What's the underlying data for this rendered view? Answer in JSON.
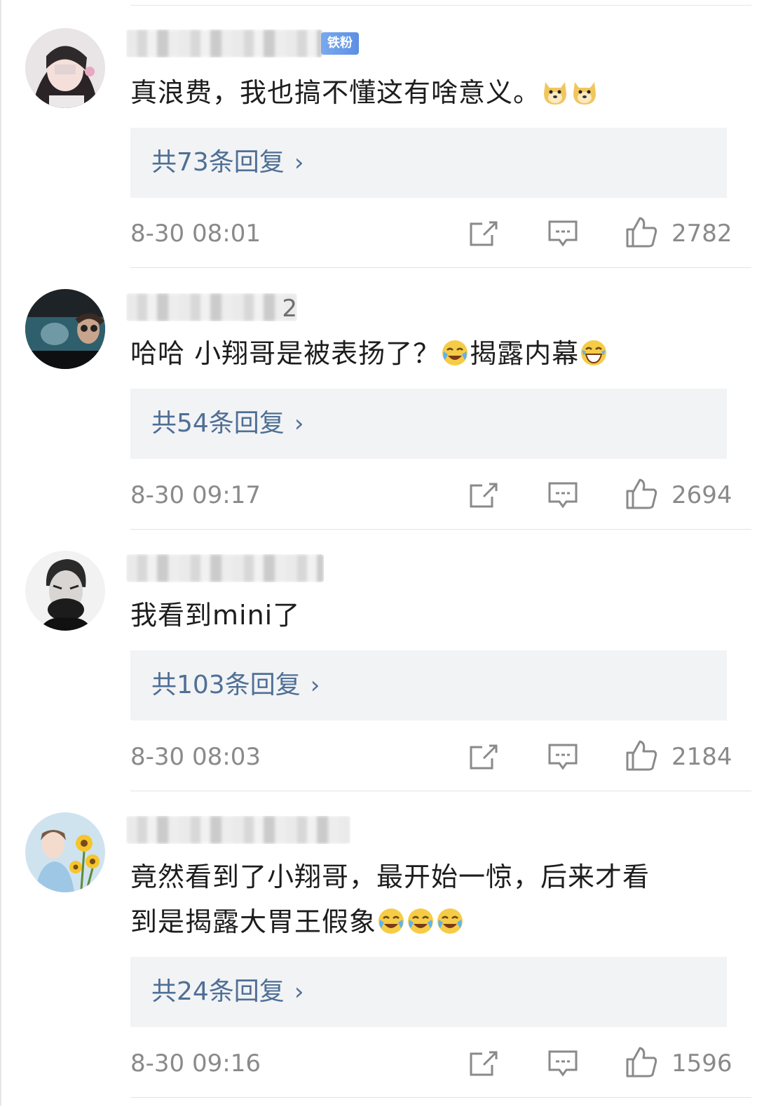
{
  "comments": [
    {
      "username_visible": "",
      "badge": "铁粉",
      "text": "真浪费，我也搞不懂这有啥意义。",
      "emojis": [
        "doge-emoji",
        "doge-emoji"
      ],
      "replies": "共73条回复",
      "time": "8-30 08:01",
      "likes": "2782"
    },
    {
      "username_visible": "2",
      "text": "哈哈 小翔哥是被表扬了？",
      "emoji_mid": "laugh-cry-emoji",
      "text2": "揭露内幕",
      "emoji_end": "grin-tears-emoji",
      "replies": "共54条回复",
      "time": "8-30 09:17",
      "likes": "2694"
    },
    {
      "username_visible": "",
      "text": "我看到mini了",
      "replies": "共103条回复",
      "time": "8-30 08:03",
      "likes": "2184"
    },
    {
      "username_visible": "",
      "text": "竟然看到了小翔哥，最开始一惊，后来才看",
      "text2": "到是揭露大胃王假象",
      "emojis": [
        "laugh-cry-emoji",
        "laugh-cry-emoji",
        "laugh-cry-emoji"
      ],
      "replies": "共24条回复",
      "time": "8-30 09:16",
      "likes": "1596"
    }
  ],
  "chevron": "›",
  "colors": {
    "reply_link": "#4f6f95",
    "meta_gray": "#8a8a8a",
    "reply_bg": "#f2f3f5"
  }
}
